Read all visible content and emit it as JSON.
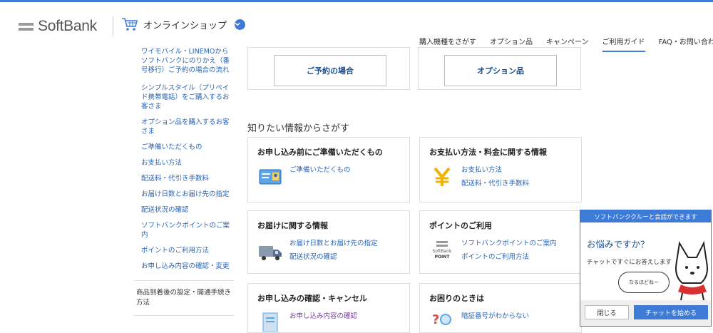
{
  "header": {
    "logo_text": "SoftBank",
    "shop_label": "オンラインショップ",
    "nav": [
      "購入機種をさがす",
      "オプション品",
      "キャンペーン",
      "ご利用ガイド",
      "FAQ・お問い合わせ"
    ],
    "active_nav": "ご利用ガイド"
  },
  "sidebar": {
    "clipped_link": "ワイモバイル・LINEMOからソフトバンクにのりかえ（番号移行）ご予約の場合の流れ",
    "links": [
      "シンプルスタイル（プリペイド携帯電話）をご購入するお客さま",
      "オプション品を購入するお客さま",
      "ご準備いただくもの",
      "お支払い方法",
      "配送料・代引き手数料",
      "お届け日数とお届け先の指定",
      "配送状況の確認",
      "ソフトバンクポイントのご案内",
      "ポイントのご利用方法",
      "お申し込み内容の確認・変更"
    ],
    "section_heading": "商品到着後の設定・開通手続き方法"
  },
  "top_buttons": [
    "ご予約の場合",
    "オプション品"
  ],
  "section_title": "知りたい情報からさがす",
  "cards": [
    {
      "title": "お申し込み前にご準備いただくもの",
      "links": [
        "ご準備いただくもの"
      ],
      "icon": "id-card-icon"
    },
    {
      "title": "お支払い方法・料金に関する情報",
      "links": [
        "お支払い方法",
        "配送料・代引き手数料"
      ],
      "icon": "yen-icon"
    },
    {
      "title": "お届けに関する情報",
      "links": [
        "お届け日数とお届け先の指定",
        "配送状況の確認"
      ],
      "icon": "truck-icon"
    },
    {
      "title": "ポイントのご利用",
      "links": [
        "ソフトバンクポイントのご案内",
        "ポイントのご利用方法"
      ],
      "icon": "softbank-point-icon",
      "icon_text": [
        "SoftBank",
        "POINT"
      ]
    },
    {
      "title": "お申し込みの確認・キャンセル",
      "links": [
        "お申し込み内容の確認"
      ],
      "icon": "document-icon"
    },
    {
      "title": "お困りのときは",
      "links": [
        "暗証番号がわからない"
      ],
      "icon": "question-magnifier-icon"
    }
  ],
  "chat": {
    "header": "ソフトバンククルーと会話ができます",
    "question": "お悩みですか？",
    "subtitle": "チャットですぐにお答えします",
    "bubble": "なるほどねー",
    "close_label": "閉じる",
    "start_label": "チャットを始める"
  },
  "colors": {
    "accent": "#3d7bd6",
    "link": "#2a64b4",
    "heading_blue": "#1c4e8c",
    "icon_yellow": "#f0b400"
  }
}
